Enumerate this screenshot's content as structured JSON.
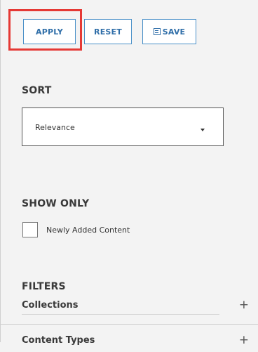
{
  "toolbar": {
    "apply_label": "APPLY",
    "reset_label": "RESET",
    "save_label": "SAVE",
    "save_icon": "floppy-disk-icon",
    "highlight_color": "#e53935",
    "button_color": "#2f6ea8"
  },
  "sort": {
    "title": "SORT",
    "selected": "Relevance",
    "dropdown_icon": "caret-down-icon"
  },
  "show_only": {
    "title": "SHOW ONLY",
    "option_label": "Newly Added Content",
    "checked": false
  },
  "filters": {
    "title": "FILTERS",
    "items": [
      {
        "label": "Collections",
        "icon": "plus-icon",
        "expand_symbol": "+"
      },
      {
        "label": "Content Types",
        "icon": "plus-icon",
        "expand_symbol": "+"
      }
    ]
  }
}
